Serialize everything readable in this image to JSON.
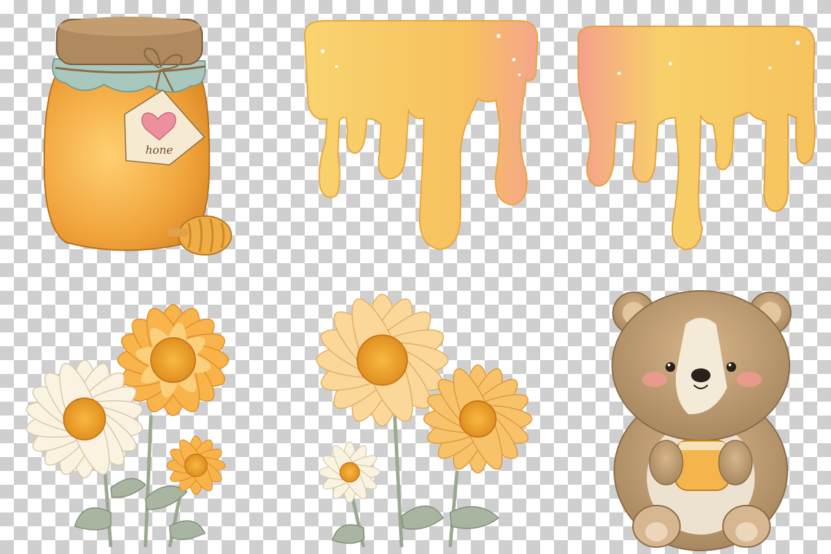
{
  "canvas": {
    "background": "transparency-checkerboard",
    "checker_colors": [
      "#ffffff",
      "#cfcfcf"
    ]
  },
  "clipart": {
    "honey_jar": {
      "tag_text": "hone",
      "glass_color": "#f3a83a",
      "lid_color": "#b08a5f"
    },
    "honey_drip_left": {
      "color_main": "#f7cc63",
      "color_blush": "#f3a18a"
    },
    "honey_drip_right": {
      "color_main": "#f7cc63",
      "color_blush": "#f3a18a"
    },
    "flowers_left": {
      "petal_white": "#fbf3e2",
      "petal_orange": "#f7b34c",
      "stem": "#9aa88f"
    },
    "flowers_middle": {
      "petal_white": "#fbf3e2",
      "petal_orange": "#f7b34c",
      "stem": "#9aa88f"
    },
    "bear": {
      "fur": "#c8a57a",
      "belly": "#ede2cf",
      "cheek": "#f39a92"
    }
  }
}
